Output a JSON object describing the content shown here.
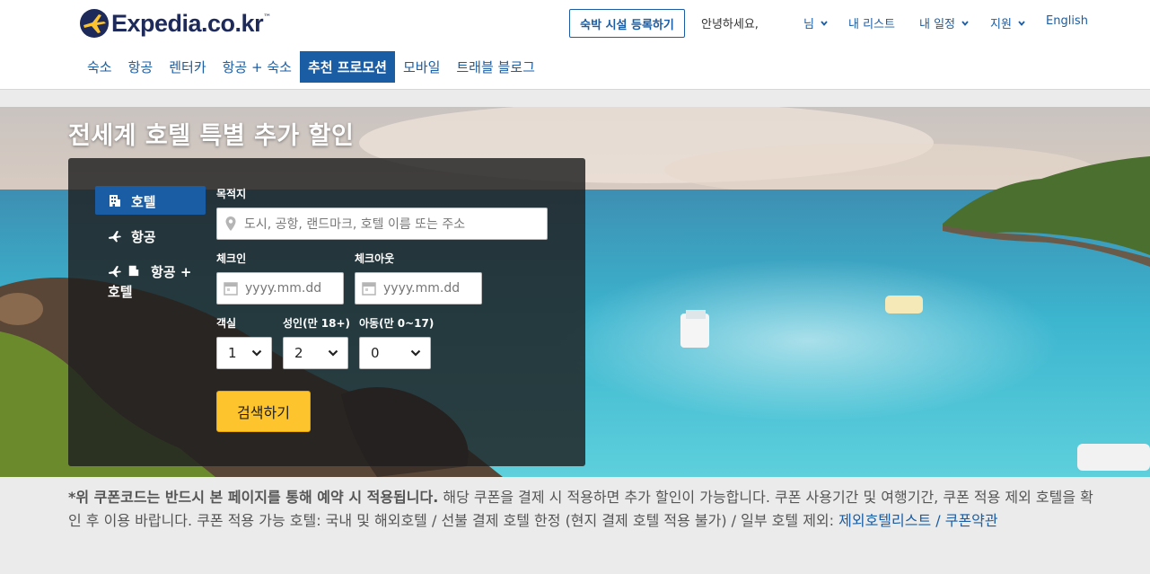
{
  "header": {
    "logo_text": "Expedia.co.kr",
    "logo_tm": "™",
    "register_button": "숙박 시설 등록하기",
    "greeting": "안녕하세요,",
    "user_menu": "님",
    "my_list": "내 리스트",
    "my_trips": "내 일정",
    "support": "지원",
    "language": "English"
  },
  "nav": {
    "items": [
      {
        "label": "숙소"
      },
      {
        "label": "항공"
      },
      {
        "label": "렌터카"
      },
      {
        "label": "항공 + 숙소"
      },
      {
        "label": "추천 프로모션",
        "active": true
      },
      {
        "label": "모바일"
      },
      {
        "label": "트래블 블로그"
      }
    ]
  },
  "hero": {
    "title": "전세계 호텔 특별 추가 할인"
  },
  "search": {
    "tabs": [
      {
        "label": "호텔",
        "icon": "hotel-icon",
        "active": true
      },
      {
        "label": "항공",
        "icon": "plane-icon"
      },
      {
        "label": "항공 +",
        "label2": "호텔",
        "icon": "plane-hotel-icon"
      }
    ],
    "destination_label": "목적지",
    "destination_placeholder": "도시, 공항, 랜드마크, 호텔 이름 또는 주소",
    "checkin_label": "체크인",
    "checkin_placeholder": "yyyy.mm.dd",
    "checkout_label": "체크아웃",
    "checkout_placeholder": "yyyy.mm.dd",
    "rooms_label": "객실",
    "rooms_value": "1",
    "adults_label": "성인(만 18+)",
    "adults_value": "2",
    "children_label": "아동(만 0~17)",
    "children_value": "0",
    "search_button": "검색하기"
  },
  "notice": {
    "bold": "*위 쿠폰코드는 반드시 본 페이지를 통해 예약 시 적용됩니다.",
    "text": " 해당 쿠폰을 결제 시 적용하면 추가 할인이 가능합니다. 쿠폰 사용기간 및 여행기간, 쿠폰 적용 제외 호텔을 확인 후 이용 바랍니다. 쿠폰 적용 가능 호텔: 국내 및 해외호텔 / 선불 결제 호텔 한정 (현지 결제 호텔 적용 불가) / 일부 호텔 제외: ",
    "link1": "제외호텔리스트",
    "sep": " / ",
    "link2": "쿠폰약관"
  },
  "colors": {
    "brand_blue": "#1a5da4",
    "logo_navy": "#1d2a5a",
    "logo_yellow": "#fec42d",
    "search_button": "#fec42d"
  }
}
